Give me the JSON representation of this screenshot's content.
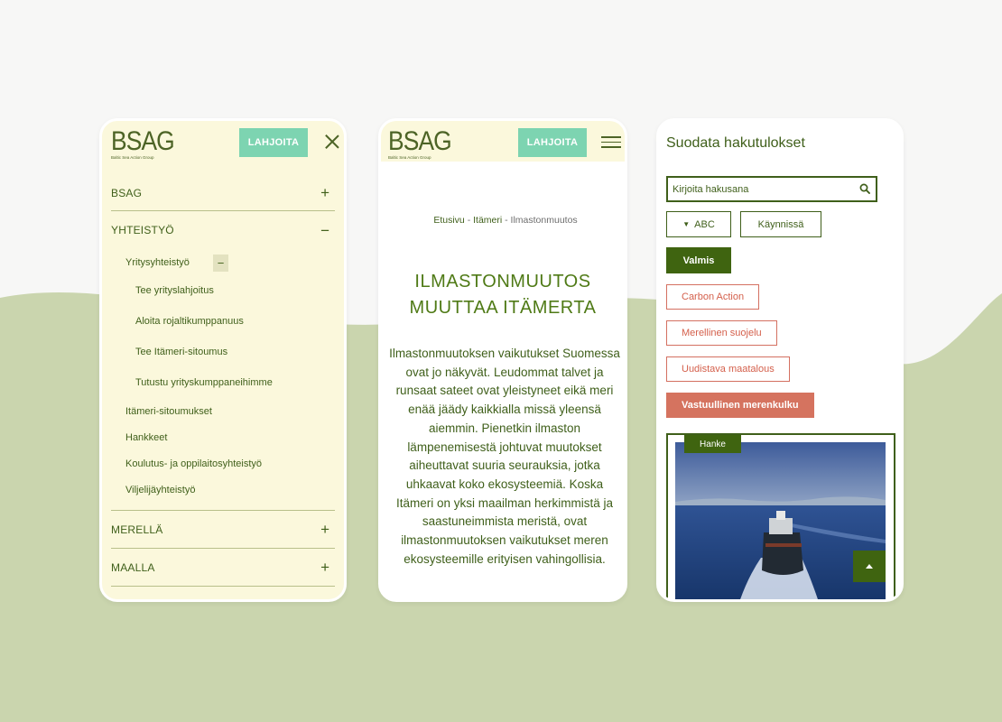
{
  "brand": {
    "logo_text": "BSAG",
    "logo_subtitle": "Baltic Sea Action Group"
  },
  "colors": {
    "brand_green": "#3f5f1a",
    "donate_mint": "#7dd4b1",
    "menu_cream": "#fbf8dc",
    "tag_red": "#d47061",
    "background_green": "#cad5ae"
  },
  "menu_screen": {
    "donate_label": "LAHJOITA",
    "close_icon": "close-icon",
    "items": [
      {
        "label": "BSAG",
        "sign": "+"
      },
      {
        "label": "YHTEISTYÖ",
        "sign": "−"
      },
      {
        "label": "MERELLÄ",
        "sign": "+"
      },
      {
        "label": "MAALLA",
        "sign": "+"
      }
    ],
    "yhteistyo_sub": {
      "expanded_label": "Yritysyhteistyö",
      "expanded_sign": "−",
      "nested": [
        "Tee yrityslahjoitus",
        "Aloita rojaltikumppanuus",
        "Tee Itämeri-sitoumus",
        "Tutustu yrityskumppaneihimme"
      ],
      "others": [
        "Itämeri-sitoumukset",
        "Hankkeet",
        "Koulutus- ja oppilaitosyhteistyö",
        "Viljelijäyhteistyö"
      ]
    }
  },
  "article_screen": {
    "donate_label": "LAHJOITA",
    "menu_icon": "hamburger-icon",
    "breadcrumb": {
      "home": "Etusivu",
      "sep": "-",
      "section": "Itämeri",
      "current": "Ilmastonmuutos"
    },
    "title_line1": "ILMASTONMUUTOS",
    "title_line2": "MUUTTAA ITÄMERTA",
    "body": "Ilmastonmuutoksen vaikutukset Suomessa ovat jo näkyvät. Leudommat talvet ja runsaat sateet ovat yleistyneet eikä meri enää jäädy kaikkialla missä yleensä aiemmin. Pienetkin ilmaston lämpenemisestä johtuvat muutokset aiheuttavat suuria seurauksia, jotka uhkaavat koko ekosysteemiä. Koska Itämeri on yksi maailman herkimmistä ja saastuneimmista meristä, ovat ilmastonmuutoksen vaikutukset meren ekosysteemille erityisen vahingollisia."
  },
  "filter_screen": {
    "title": "Suodata hakutulokset",
    "search": {
      "placeholder": "Kirjoita hakusana",
      "value": ""
    },
    "sort_label": "ABC",
    "status_ongoing": "Käynnissä",
    "status_done": "Valmis",
    "tags": [
      "Carbon Action",
      "Merellinen suojelu",
      "Uudistava maatalous",
      "Vastuullinen merenkulku"
    ],
    "card_badge": "Hanke",
    "scroll_top_icon": "arrow-up-icon"
  }
}
